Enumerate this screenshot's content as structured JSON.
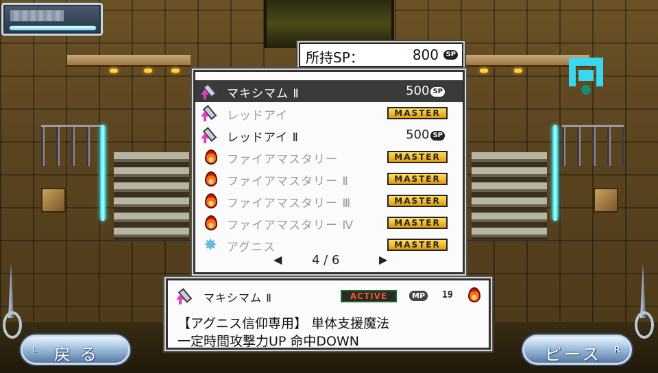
{
  "sp": {
    "label": "所持SP：",
    "value": "800",
    "badge": "SP"
  },
  "skills": [
    {
      "name": "マキシマム Ⅱ",
      "icon": "sword-up-icon",
      "status": "cost",
      "cost": "500",
      "badge": "SP",
      "selected": true
    },
    {
      "name": "レッドアイ",
      "icon": "sword-up-icon",
      "status": "master",
      "master": "MASTER"
    },
    {
      "name": "レッドアイ Ⅱ",
      "icon": "sword-up-icon",
      "status": "cost",
      "cost": "500",
      "badge": "SP"
    },
    {
      "name": "ファイアマスタリー",
      "icon": "fire-icon",
      "status": "master",
      "master": "MASTER"
    },
    {
      "name": "ファイアマスタリー Ⅱ",
      "icon": "fire-icon",
      "status": "master",
      "master": "MASTER"
    },
    {
      "name": "ファイアマスタリー Ⅲ",
      "icon": "fire-icon",
      "status": "master",
      "master": "MASTER"
    },
    {
      "name": "ファイアマスタリー Ⅳ",
      "icon": "fire-icon",
      "status": "master",
      "master": "MASTER"
    },
    {
      "name": "アグニス",
      "icon": "star-burst-icon",
      "status": "master",
      "master": "MASTER"
    }
  ],
  "pager": {
    "prev": "◀",
    "page": "4 / 6",
    "next": "▶"
  },
  "info": {
    "title": "マキシマム Ⅱ",
    "icon": "sword-up-icon",
    "active": "ACTIVE",
    "mp_label": "MP",
    "mp_value": "19",
    "element_icon": "fire-icon",
    "desc_line1": "【アグニス信仰専用】 単体支援魔法",
    "desc_line2": "一定時間攻撃力UP 命中DOWN"
  },
  "buttons": {
    "back_label": "戻る",
    "back_key": "L",
    "piece_label": "ピース",
    "piece_key": "R"
  },
  "colors": {
    "accent_cyan": "#3ad8ee",
    "master_gold": "#ffd040",
    "active_red": "#ff5030"
  }
}
